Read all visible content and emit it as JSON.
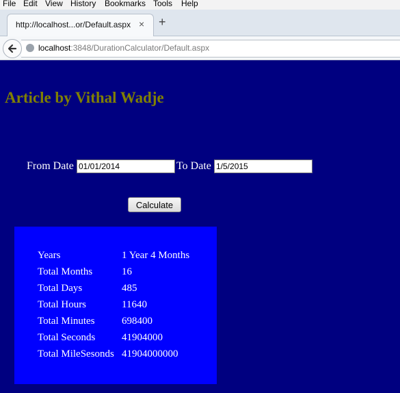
{
  "menu": [
    "File",
    "Edit",
    "View",
    "History",
    "Bookmarks",
    "Tools",
    "Help"
  ],
  "tab": {
    "title": "http://localhost...or/Default.aspx",
    "close": "×",
    "new_tab": "+"
  },
  "address": {
    "host": "localhost",
    "path": ":3848/DurationCalculator/Default.aspx"
  },
  "page": {
    "title": "Article by Vithal Wadje",
    "from_label": "From Date",
    "from_value": "01/01/2014",
    "to_label": "To Date",
    "to_value": "1/5/2015",
    "calculate_label": "Calculate"
  },
  "results": [
    {
      "label": "Years",
      "value": "1 Year 4 Months"
    },
    {
      "label": "Total Months",
      "value": "16"
    },
    {
      "label": "Total Days",
      "value": "485"
    },
    {
      "label": "Total Hours",
      "value": "11640"
    },
    {
      "label": "Total Minutes",
      "value": "698400"
    },
    {
      "label": "Total Seconds",
      "value": "41904000"
    },
    {
      "label": "Total MileSesonds",
      "value": "41904000000"
    }
  ],
  "colors": {
    "page_bg": "#000080",
    "title": "#808000",
    "panel_bg": "#0000ff"
  }
}
